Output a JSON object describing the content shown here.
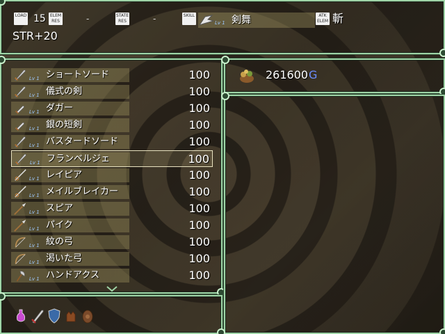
{
  "status": {
    "load_tag": "LOAD",
    "load_value": "15",
    "elem_res_tag": "ELEM RES",
    "elem_res_value": "-",
    "state_res_tag": "STATE RES",
    "state_res_value": "-",
    "skill_tag": "SKILL",
    "skill_level": "Lv 1",
    "skill_name": "剣舞",
    "atk_elem_tag": "ATK ELEM",
    "atk_elem_value": "斬",
    "bonus": "STR+20"
  },
  "items": [
    {
      "name": "ショートソード",
      "level": "Lv 1",
      "qty": "100",
      "icon": "sword-icon"
    },
    {
      "name": "儀式の剣",
      "level": "Lv 1",
      "qty": "100",
      "icon": "sword-icon"
    },
    {
      "name": "ダガー",
      "level": "Lv 1",
      "qty": "100",
      "icon": "dagger-icon"
    },
    {
      "name": "銀の短剣",
      "level": "Lv 1",
      "qty": "100",
      "icon": "dagger-icon"
    },
    {
      "name": "バスタードソード",
      "level": "Lv 1",
      "qty": "100",
      "icon": "sword-icon"
    },
    {
      "name": "フランベルジェ",
      "level": "Lv 1",
      "qty": "100",
      "icon": "sword-icon"
    },
    {
      "name": "レイピア",
      "level": "Lv 1",
      "qty": "100",
      "icon": "rapier-icon"
    },
    {
      "name": "メイルブレイカー",
      "level": "Lv 1",
      "qty": "100",
      "icon": "rapier-icon"
    },
    {
      "name": "スピア",
      "level": "Lv 1",
      "qty": "100",
      "icon": "spear-icon"
    },
    {
      "name": "パイク",
      "level": "Lv 1",
      "qty": "100",
      "icon": "spear-icon"
    },
    {
      "name": "紋の弓",
      "level": "Lv 1",
      "qty": "100",
      "icon": "bow-icon"
    },
    {
      "name": "渇いた弓",
      "level": "Lv 1",
      "qty": "100",
      "icon": "bow-icon"
    },
    {
      "name": "ハンドアクス",
      "level": "Lv 1",
      "qty": "100",
      "icon": "axe-icon"
    }
  ],
  "selected_index": 5,
  "gold": {
    "amount": "261600",
    "unit": "G"
  },
  "equipment_icons": [
    "potion-icon",
    "sword-icon",
    "shield-icon",
    "gloves-icon",
    "boots-icon"
  ],
  "colors": {
    "frame": "#9fd4a6",
    "level_text": "#9ec9ff",
    "gold_unit": "#6a8cff",
    "row_highlight": "#a0965f"
  }
}
